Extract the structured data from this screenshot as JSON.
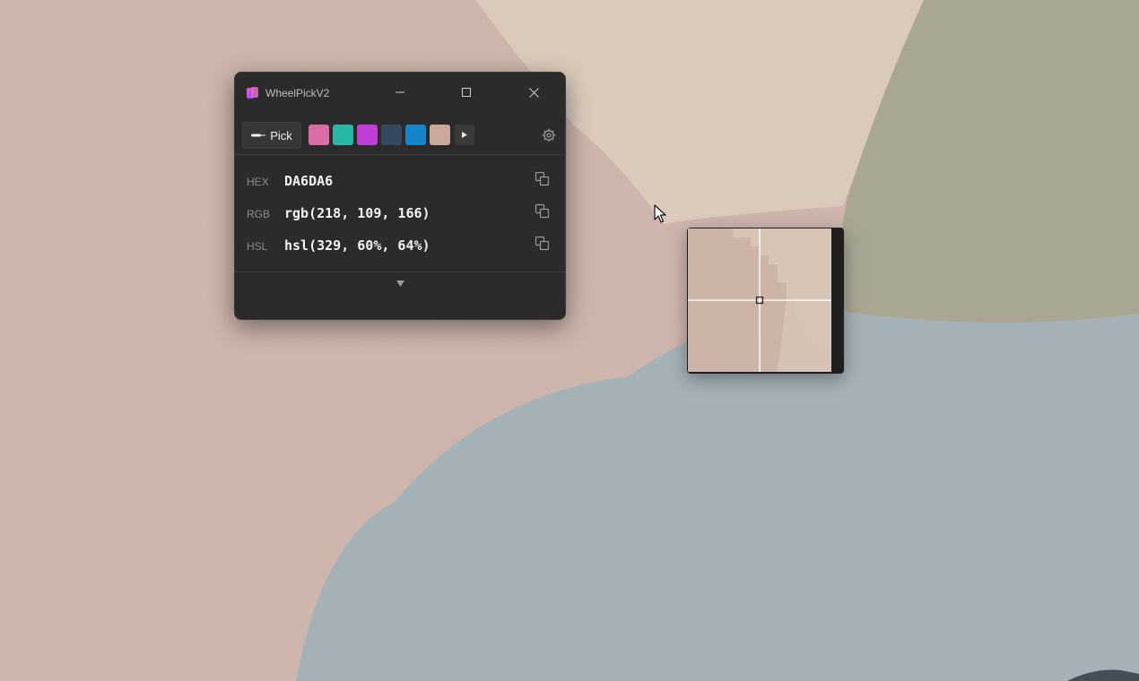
{
  "window": {
    "title": "WheelPickV2",
    "controls": [
      "minimize-icon",
      "maximize-icon",
      "close-icon"
    ]
  },
  "toolbar": {
    "pick_label": "Pick",
    "pick_icon": "eyedropper-icon",
    "history_swatches": [
      "#DA6DA6",
      "#26B8A5",
      "#C03DD8",
      "#34495E",
      "#1485CB",
      "#CBA89C"
    ],
    "more_icon": "play-arrow-icon",
    "settings_icon": "gear-icon"
  },
  "color_values": [
    {
      "label": "HEX",
      "value": "DA6DA6"
    },
    {
      "label": "RGB",
      "value": "rgb(218, 109, 166)"
    },
    {
      "label": "HSL",
      "value": "hsl(329, 60%, 64%)"
    }
  ],
  "expand_icon": "triangle-down-icon",
  "magnifier": {
    "crosshair_icon": "crosshair-icon"
  },
  "cursor_icon": "arrow-cursor-icon"
}
